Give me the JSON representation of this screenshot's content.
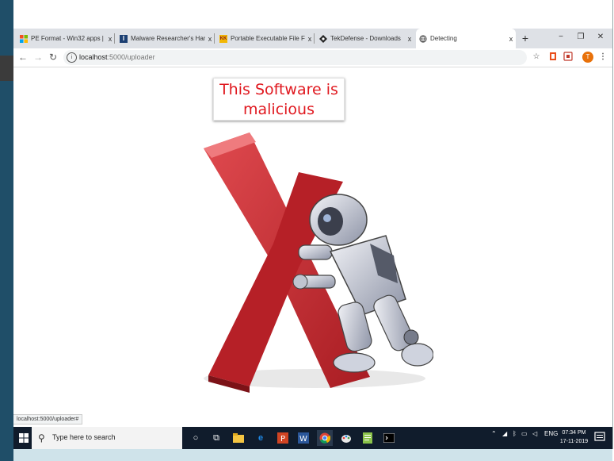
{
  "browser": {
    "tabs": [
      {
        "title": "PE Format - Win32 apps | Micr",
        "favicon": "windows-logo-icon",
        "active": false
      },
      {
        "title": "Malware Researcher's Handbo",
        "favicon": "book-icon",
        "active": false
      },
      {
        "title": "Portable Executable File Forma",
        "favicon": "kk-icon",
        "active": false
      },
      {
        "title": "TekDefense - Downloads",
        "favicon": "shield-icon",
        "active": false
      },
      {
        "title": "Detecting",
        "favicon": "globe-icon",
        "active": true
      }
    ],
    "close_glyph": "x",
    "new_tab": "+",
    "window_buttons": {
      "minimize": "−",
      "maximize": "❐",
      "close": "✕"
    },
    "url_host": "localhost",
    "url_path": ":5000/uploader",
    "profile_initial": "T"
  },
  "page": {
    "banner_line1": "This Software is",
    "banner_line2": "malicious",
    "illustration": "robot-pushing-red-x-icon"
  },
  "status_url": "localhost:5000/uploader#",
  "taskbar": {
    "search_placeholder": "Type here to search",
    "language": "ENG",
    "time": "07:34 PM",
    "date": "17-11-2019"
  },
  "colors": {
    "banner_text": "#e0181f",
    "x_mark": "#c8262c",
    "taskbar": "#101c2c",
    "profile": "#e8710a"
  }
}
